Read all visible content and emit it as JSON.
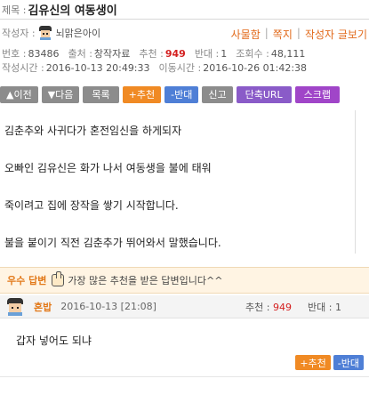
{
  "post": {
    "title_prefix": "제목 :",
    "title": "김유신의 여동생이",
    "author_label": "작성자 :",
    "author_name": "뇌맑은아이",
    "author_actions": [
      "사물함",
      "쪽지",
      "작성자 글보기"
    ],
    "meta": {
      "no_label": "번호 :",
      "no": "83486",
      "source_label": "출처 :",
      "source": "창작자료",
      "rec_label": "추천 :",
      "rec": "949",
      "opp_label": "반대 :",
      "opp": "1",
      "views_label": "조회수 :",
      "views": "48,111",
      "created_label": "작성시간 :",
      "created": "2016-10-13 20:49:33",
      "moved_label": "이동시간 :",
      "moved": "2016-10-26 01:42:38"
    },
    "buttons": [
      "▲이전",
      "▼다음",
      "목록",
      "+추천",
      "-반대",
      "신고",
      "단축URL",
      "스크랩"
    ],
    "paragraphs": [
      "김춘추와 사귀다가 혼전임신을 하게되자",
      "오빠인 김유신은 화가 나서 여동생을 불에 태워",
      "죽이려고 집에 장작을 쌓기 시작합니다.",
      "불을 붙이기 직전 김춘추가 뛰어와서 말했습니다."
    ]
  },
  "best_reply": {
    "label": "우수 답변",
    "text": "가장 많은 추천을 받은 답변입니다^^",
    "author": "혼밥",
    "date": "2016-10-13 [21:08]",
    "rec_label": "추천 :",
    "rec": "949",
    "opp_label": "반대 :",
    "opp": "1",
    "content": "갑자 넣어도 되냐",
    "btn_rec": "+추천",
    "btn_opp": "-반대"
  },
  "colors": {
    "accent_orange": "#f08a24",
    "accent_blue": "#4f7fd6",
    "count_red": "#d42020"
  }
}
